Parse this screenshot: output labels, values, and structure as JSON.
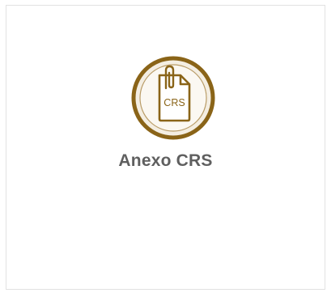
{
  "card": {
    "title": "Anexo CRS",
    "icon": "clipped-document-icon",
    "icon_text": "CRS",
    "accent_color": "#8a6418"
  }
}
